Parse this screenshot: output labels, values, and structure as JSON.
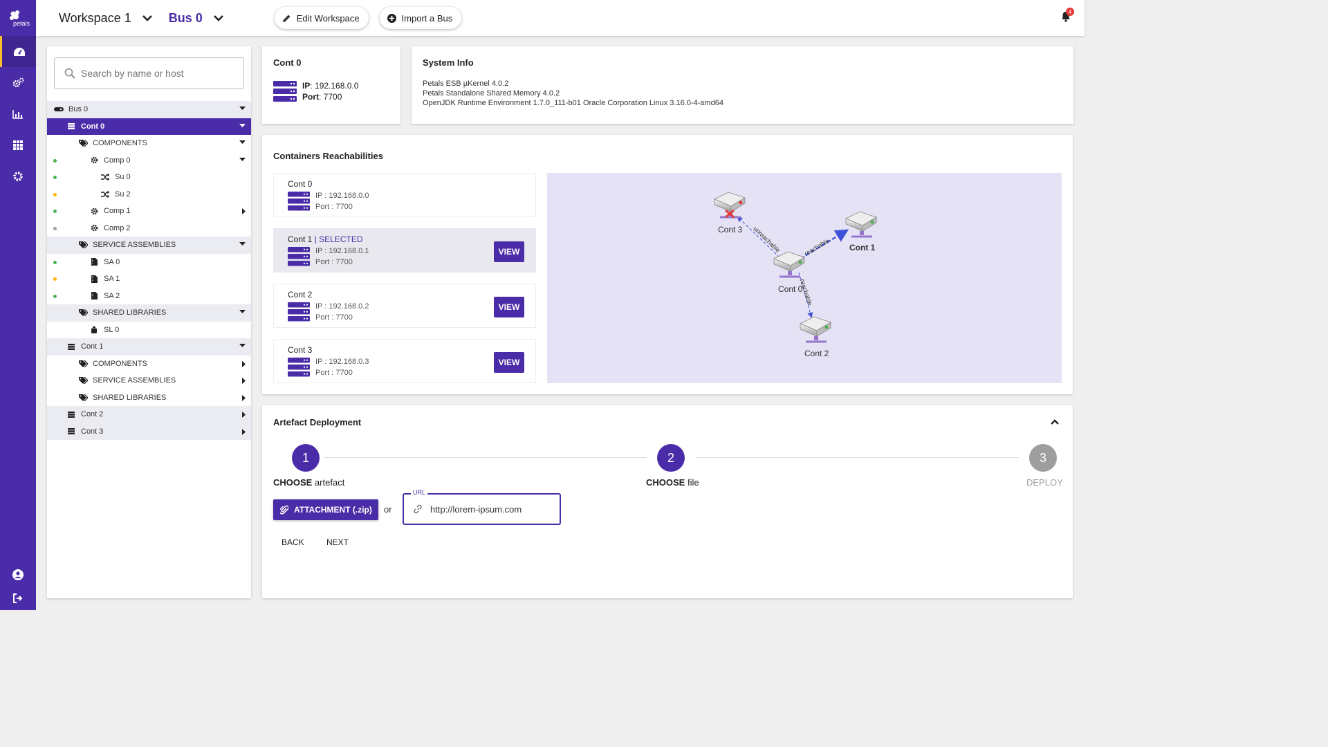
{
  "app": {
    "logo_text": "petals"
  },
  "header": {
    "workspace": "Workspace 1",
    "bus": "Bus 0",
    "edit_workspace": "Edit Workspace",
    "import_bus": "Import a Bus",
    "notification_count": "4"
  },
  "colors": {
    "primary": "#4a2ca8",
    "accent": "#fbc02d",
    "green": "#4caf50",
    "orange": "#ffb300",
    "gray": "#9e9e9e",
    "red": "#e53935"
  },
  "sidebar": {
    "items": [
      {
        "name": "dashboard-icon",
        "active": true
      },
      {
        "name": "gears-icon",
        "active": false
      },
      {
        "name": "chart-icon",
        "active": false
      },
      {
        "name": "apps-icon",
        "active": false
      },
      {
        "name": "settings-icon",
        "active": false
      }
    ],
    "bottom": [
      {
        "name": "account-icon"
      },
      {
        "name": "logout-icon"
      }
    ]
  },
  "search": {
    "placeholder": "Search by name or host"
  },
  "tree": {
    "bus0": "Bus 0",
    "cont0": "Cont 0",
    "components": "COMPONENTS",
    "comp0": "Comp 0",
    "su0": "Su 0",
    "su2": "Su 2",
    "comp1": "Comp 1",
    "comp2": "Comp 2",
    "service_assemblies": "SERVICE ASSEMBLIES",
    "sa0": "SA 0",
    "sa1": "SA 1",
    "sa2": "SA 2",
    "shared_libraries": "SHARED LIBRARIES",
    "sl0": "SL 0",
    "cont1": "Cont 1",
    "cont1_components": "COMPONENTS",
    "cont1_service_assemblies": "SERVICE ASSEMBLIES",
    "cont1_shared_libraries": "SHARED LIBRARIES",
    "cont2": "Cont 2",
    "cont3": "Cont 3"
  },
  "container": {
    "title": "Cont 0",
    "ip_label": "IP",
    "ip": "192.168.0.0",
    "port_label": "Port",
    "port": "7700"
  },
  "system_info": {
    "title": "System Info",
    "lines": [
      "Petals ESB µKernel 4.0.2",
      "Petals Standalone Shared Memory 4.0.2",
      "OpenJDK Runtime Environment 1.7.0_111-b01 Oracle Corporation Linux 3.16.0-4-amd64"
    ]
  },
  "reachabilities": {
    "title": "Containers Reachabilities",
    "view_label": "VIEW",
    "items": [
      {
        "name": "Cont 0",
        "ip": "IP : 192.168.0.0",
        "port": "Port : 7700"
      },
      {
        "name": "Cont 1",
        "selected_tag": "| SELECTED",
        "ip": "IP : 192.168.0.1",
        "port": "Port : 7700"
      },
      {
        "name": "Cont 2",
        "ip": "IP : 192.168.0.2",
        "port": "Port : 7700"
      },
      {
        "name": "Cont 3",
        "ip": "IP : 192.168.0.3",
        "port": "Port : 7700"
      }
    ],
    "graph": {
      "nodes": {
        "cont0": "Cont 0",
        "cont1": "Cont 1",
        "cont2": "Cont 2",
        "cont3": "Cont 3"
      },
      "edges": {
        "to_cont1": "reachable",
        "to_cont2": "reachable",
        "to_cont3": "unreachable"
      }
    }
  },
  "deployment": {
    "title": "Artefact Deployment",
    "steps": [
      {
        "number": "1",
        "label_bold": "CHOOSE",
        "label_rest": " artefact"
      },
      {
        "number": "2",
        "label_bold": "CHOOSE",
        "label_rest": " file"
      },
      {
        "number": "3",
        "label": "DEPLOY"
      }
    ],
    "attachment_label": "ATTACHMENT (.zip)",
    "or_text": "or",
    "url_label": "URL",
    "url_value": "http://lorem-ipsum.com",
    "back_label": "BACK",
    "next_label": "NEXT"
  }
}
